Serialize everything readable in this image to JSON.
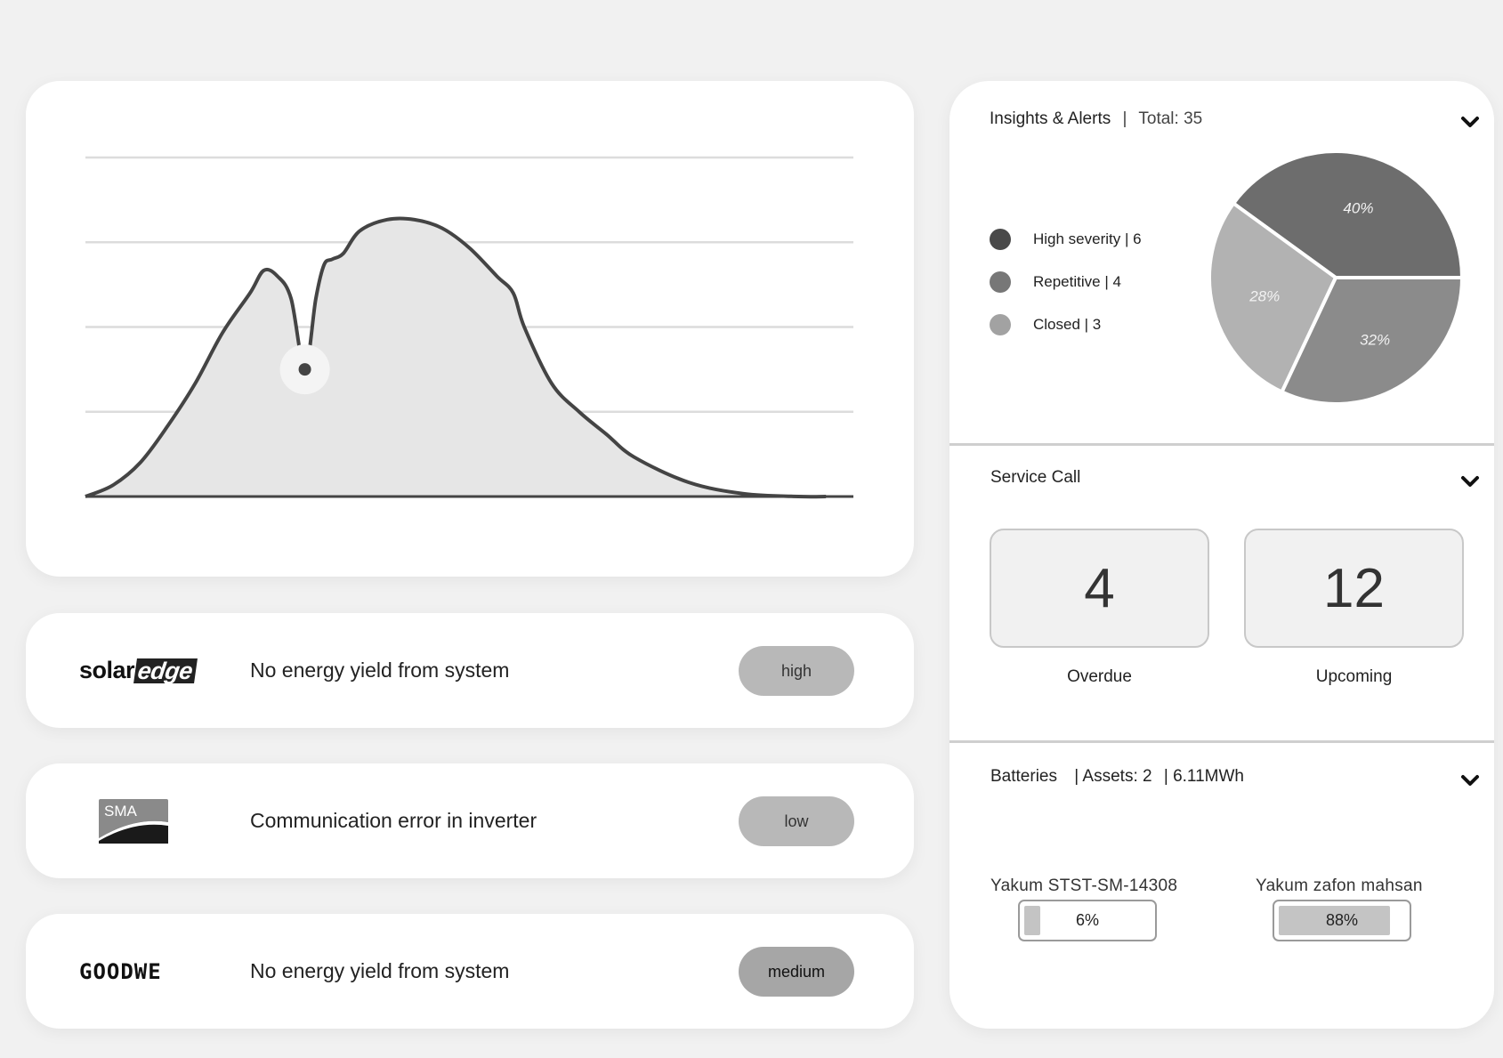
{
  "chart_data": {
    "type": "area",
    "description_hours": [
      6,
      20
    ],
    "x": [
      6.0,
      6.5,
      7.0,
      7.5,
      8.0,
      8.5,
      9.0,
      9.25,
      9.5,
      9.75,
      10.0,
      10.2,
      10.35,
      10.5,
      10.7,
      11.0,
      11.5,
      12.0,
      12.5,
      13.0,
      13.5,
      13.8,
      14.0,
      14.5,
      15.0,
      15.5,
      16.0,
      17.0,
      18.0,
      19.0,
      19.5
    ],
    "y": [
      0,
      4,
      12,
      25,
      40,
      58,
      72,
      80,
      78,
      70,
      45,
      70,
      82,
      84,
      86,
      94,
      98,
      98,
      95,
      88,
      78,
      72,
      60,
      40,
      30,
      22,
      14,
      5,
      1,
      0,
      0
    ],
    "highlight_point": {
      "x": 10.0,
      "y": 45
    },
    "ylim": [
      0,
      120
    ],
    "gridlines": 4,
    "xlabel": "",
    "ylabel": "",
    "title": ""
  },
  "alerts": [
    {
      "brand": "solaredge",
      "brand_parts": [
        "solar",
        "edge"
      ],
      "message": "No energy yield from system",
      "severity": "high"
    },
    {
      "brand": "SMA",
      "message": "Communication error in inverter",
      "severity": "low"
    },
    {
      "brand": "GOODWE",
      "message": "No energy yield from system",
      "severity": "medium"
    }
  ],
  "insights": {
    "title": "Insights & Alerts",
    "separator": "|",
    "total": "Total: 35",
    "legend": [
      {
        "label": "High severity | 6",
        "color": "#4a4a4a"
      },
      {
        "label": "Repetitive | 4",
        "color": "#777777"
      },
      {
        "label": "Closed | 3",
        "color": "#a2a2a2"
      }
    ],
    "pie": [
      {
        "label": "40%",
        "value": 40,
        "color": "#6d6d6d"
      },
      {
        "label": "32%",
        "value": 32,
        "color": "#8b8b8b"
      },
      {
        "label": "28%",
        "value": 28,
        "color": "#b2b2b2"
      }
    ]
  },
  "service_call": {
    "title": "Service Call",
    "overdue_value": "4",
    "overdue_label": "Overdue",
    "upcoming_value": "12",
    "upcoming_label": "Upcoming"
  },
  "batteries": {
    "title": "Batteries",
    "assets": "| Assets: 2",
    "capacity": "| 6.11MWh",
    "items": [
      {
        "name": "Yakum STST-SM-14308",
        "percent_label": "6%",
        "level": 0.06
      },
      {
        "name": "Yakum zafon mahsan",
        "percent_label": "88%",
        "level": 0.88
      }
    ]
  }
}
